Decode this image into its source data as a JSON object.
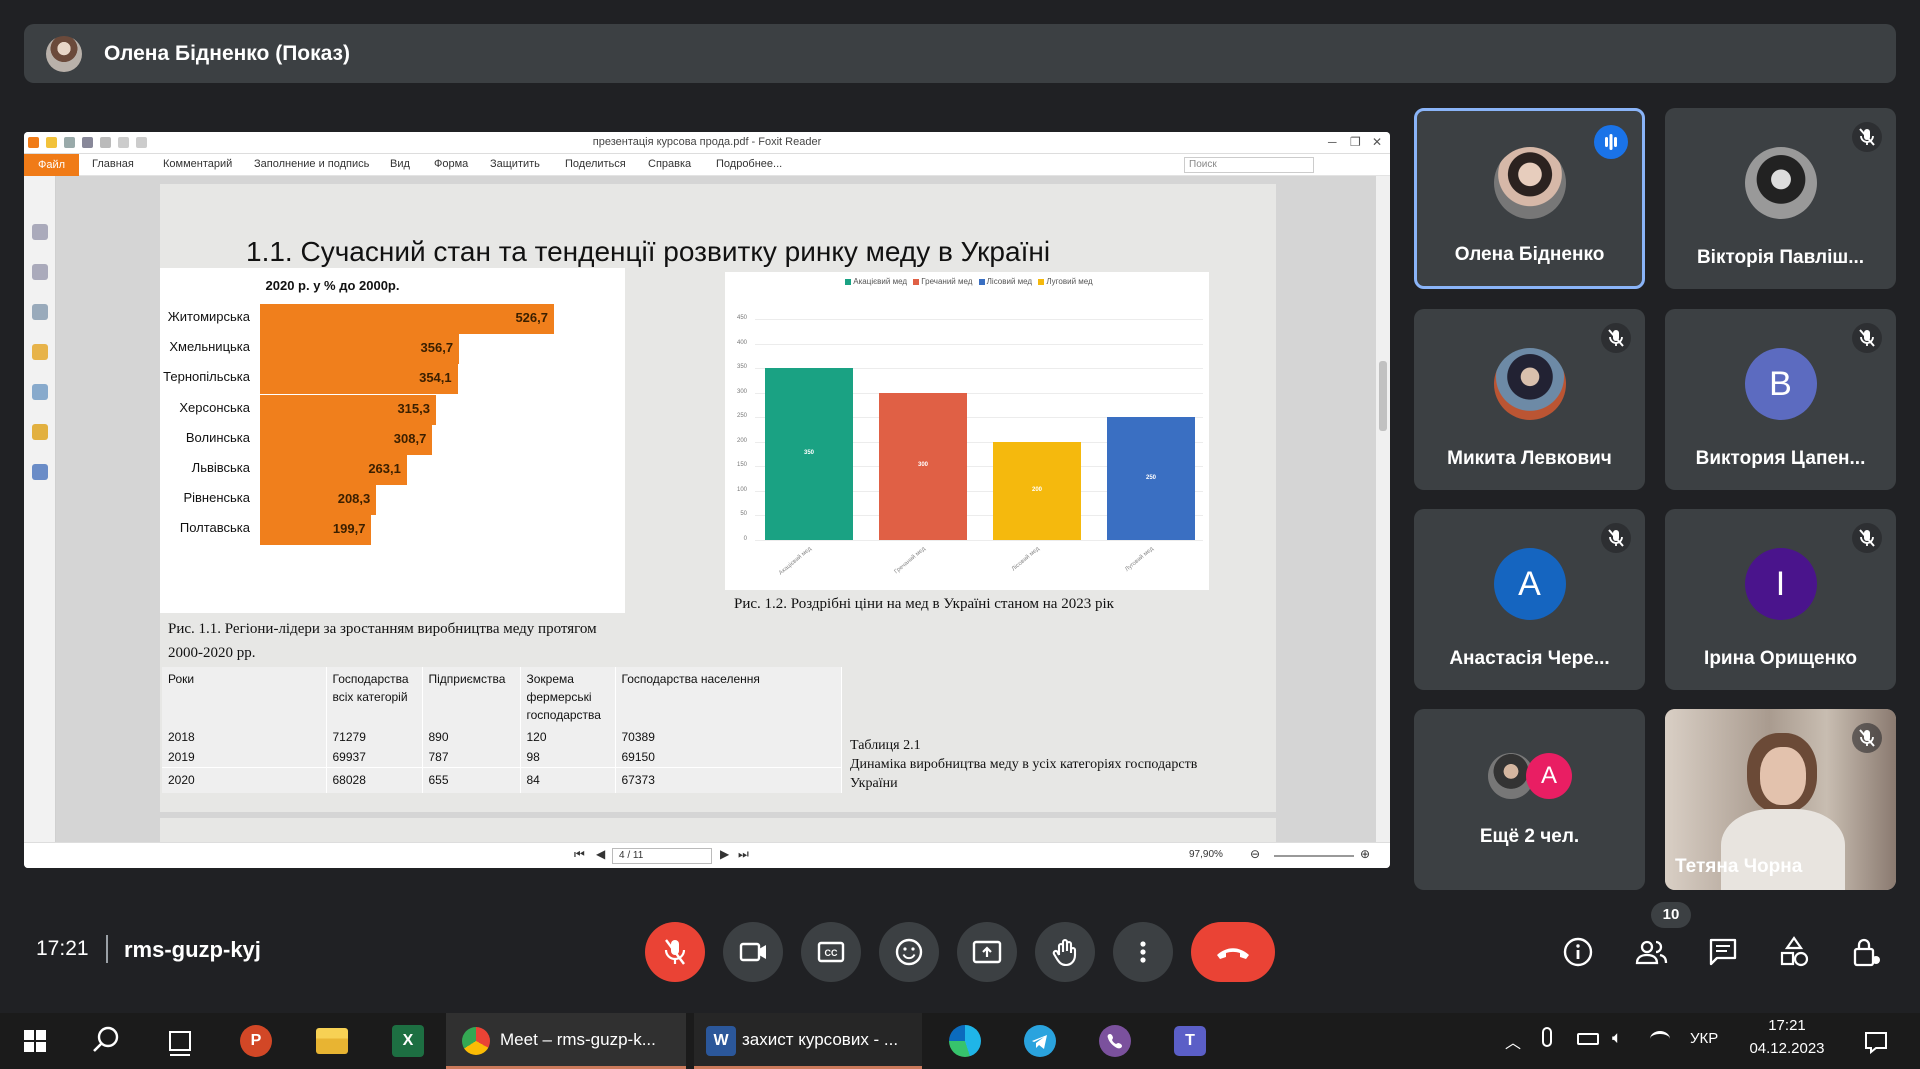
{
  "presenter": {
    "banner_title": "Олена Бідненко (Показ)"
  },
  "viewer": {
    "window_title": "презентація курсова прода.pdf - Foxit Reader",
    "file_menu": "Файл",
    "menu": [
      "Главная",
      "Комментарий",
      "Заполнение и подпись",
      "Вид",
      "Форма",
      "Защитить",
      "Поделиться",
      "Справка",
      "Подробнее..."
    ],
    "search_placeholder": "Поиск",
    "page_indicator": "4 / 11",
    "zoom": "97,90%"
  },
  "slide": {
    "title": "1.1. Сучасний стан та тенденції розвитку ринку меду в Україні",
    "caption_fig1": "Рис. 1.1. Регіони-лідери за зростанням виробництва меду протягом 2000-2020 рр.",
    "caption_fig2": "Рис. 1.2. Роздрібні ціни на мед в Україні станом на 2023 рік",
    "table": {
      "headers": [
        "Роки",
        "Господарства всіх категорій",
        "Підприємства",
        "Зокрема фермерські господарства",
        "Господарства населення"
      ],
      "rows": [
        [
          "2018",
          "71279",
          "890",
          "120",
          "70389"
        ],
        [
          "2019",
          "69937",
          "787",
          "98",
          "69150"
        ],
        [
          "2020",
          "68028",
          "655",
          "84",
          "67373"
        ]
      ]
    },
    "table_caption_1": "Таблиця 2.1",
    "table_caption_2": "Динаміка виробництва меду в усіх категоріях господарств України"
  },
  "chart_data": [
    {
      "type": "bar",
      "orientation": "horizontal",
      "title": "2020 р. у % до 2000р.",
      "categories": [
        "Житомирська",
        "Хмельницька",
        "Тернопільська",
        "Херсонська",
        "Волинська",
        "Львівська",
        "Рівненська",
        "Полтавська"
      ],
      "values": [
        526.7,
        356.7,
        354.1,
        315.3,
        308.7,
        263.1,
        208.3,
        199.7
      ],
      "value_labels": [
        "526,7",
        "356,7",
        "354,1",
        "315,3",
        "308,7",
        "263,1",
        "208,3",
        "199,7"
      ],
      "color": "#f07f1c"
    },
    {
      "type": "bar",
      "legend": [
        "Акацієвий мед",
        "Гречаний мед",
        "Лісовий мед",
        "Луговий мед"
      ],
      "legend_position": "top",
      "categories": [
        "Акацієвий мед",
        "Гречаний мед",
        "Лісовий мед",
        "Луговий мед"
      ],
      "values": [
        350,
        300,
        200,
        250
      ],
      "value_labels": [
        "350",
        "300",
        "200",
        "250"
      ],
      "colors": [
        "#1aa283",
        "#e06045",
        "#f5b90d",
        "#3a6fc2"
      ],
      "yticks": [
        "450",
        "400",
        "350",
        "300",
        "250",
        "200",
        "150",
        "100",
        "50",
        "0"
      ],
      "ylim": [
        0,
        450
      ]
    }
  ],
  "participants": [
    {
      "name": "Олена Бідненко",
      "speaking": true
    },
    {
      "name": "Вікторія Павліш...",
      "muted": true
    },
    {
      "name": "Микита Левкович",
      "muted": true
    },
    {
      "name": "Виктория Цапен...",
      "initial": "В",
      "color": "#5c6bc0",
      "muted": true
    },
    {
      "name": "Анастасія Чере...",
      "initial": "А",
      "color": "#1565c0",
      "muted": true
    },
    {
      "name": "Ірина Орищенко",
      "initial": "І",
      "color": "#4a148c",
      "muted": true
    },
    {
      "name": "Ещё 2 чел.",
      "initial": "А",
      "color": "#e91e63"
    },
    {
      "name": "Тетяна Чорна",
      "muted": true
    }
  ],
  "meeting": {
    "time": "17:21",
    "code": "rms-guzp-kyj",
    "participant_count": "10"
  },
  "taskbar": {
    "chrome_label": "Meet – rms-guzp-k...",
    "word_label": "захист курсових - ...",
    "lang": "УКР",
    "time": "17:21",
    "date": "04.12.2023"
  }
}
